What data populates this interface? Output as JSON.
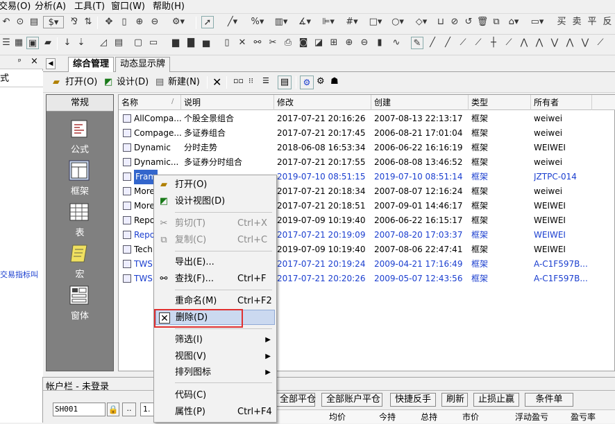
{
  "menubar": {
    "items": [
      "交易(O)",
      "分析(A)",
      "工具(T)",
      "窗口(W)",
      "帮助(H)"
    ]
  },
  "leftpane": {
    "title_fragment": "式",
    "pin": "ᵖ",
    "close": "×",
    "side_text": "交易指标叫"
  },
  "tabs": {
    "back_arrow": "◀",
    "items": [
      "综合管理",
      "动态显示牌"
    ]
  },
  "cmdbar": {
    "open": "打开(O)",
    "design": "设计(D)",
    "new": "新建(N)"
  },
  "categories": {
    "header": "常规",
    "items": [
      "公式",
      "框架",
      "表",
      "宏",
      "窗体"
    ]
  },
  "list": {
    "columns": [
      "名称",
      "说明",
      "修改",
      "创建",
      "类型",
      "所有者"
    ],
    "rows": [
      {
        "name": "AllCompa...",
        "desc": "个股全景组合",
        "mod": "2017-07-21 20:16:26",
        "created": "2007-08-13 22:13:17",
        "type": "框架",
        "owner": "weiwei",
        "blue": false
      },
      {
        "name": "Compage...",
        "desc": "多证券组合",
        "mod": "2017-07-21 20:17:45",
        "created": "2006-08-21 17:01:04",
        "type": "框架",
        "owner": "weiwei",
        "blue": false
      },
      {
        "name": "Dynamic",
        "desc": "分时走势",
        "mod": "2018-06-08 16:53:34",
        "created": "2006-06-22 16:16:19",
        "type": "框架",
        "owner": "WEIWEI",
        "blue": false
      },
      {
        "name": "Dynamic...",
        "desc": "多证券分时组合",
        "mod": "2017-07-21 20:17:55",
        "created": "2006-08-08 13:46:52",
        "type": "框架",
        "owner": "weiwei",
        "blue": false
      },
      {
        "name": "Fram",
        "desc": "",
        "mod": "2019-07-10 08:51:15",
        "created": "2019-07-10 08:51:14",
        "type": "框架",
        "owner": "JZTPC-014",
        "blue": true
      },
      {
        "name": "More",
        "desc": "",
        "mod": "2017-07-21 20:18:34",
        "created": "2007-08-07 12:16:24",
        "type": "框架",
        "owner": "weiwei",
        "blue": false
      },
      {
        "name": "More",
        "desc": "",
        "mod": "2017-07-21 20:18:51",
        "created": "2007-09-01 14:46:17",
        "type": "框架",
        "owner": "WEIWEI",
        "blue": false
      },
      {
        "name": "Repo",
        "desc": "",
        "mod": "2019-07-09 10:19:40",
        "created": "2006-06-22 16:15:17",
        "type": "框架",
        "owner": "WEIWEI",
        "blue": false
      },
      {
        "name": "Repo",
        "desc": "",
        "mod": "2017-07-21 20:19:09",
        "created": "2007-08-20 17:03:37",
        "type": "框架",
        "owner": "WEIWEI",
        "blue": true
      },
      {
        "name": "Tech",
        "desc": "",
        "mod": "2019-07-09 10:19:40",
        "created": "2007-08-06 22:47:41",
        "type": "框架",
        "owner": "WEIWEI",
        "blue": false
      },
      {
        "name": "TWS",
        "desc": "",
        "mod": "2017-07-21 20:19:24",
        "created": "2009-04-21 17:16:49",
        "type": "框架",
        "owner": "A-C1F597B...",
        "blue": true
      },
      {
        "name": "TWS",
        "desc": "",
        "mod": "2017-07-21 20:20:26",
        "created": "2009-05-07 12:43:56",
        "type": "框架",
        "owner": "A-C1F597B...",
        "blue": true
      }
    ]
  },
  "context_menu": {
    "items": [
      {
        "label": "打开(O)",
        "shortcut": "",
        "disabled": false,
        "icon": "open-icon"
      },
      {
        "label": "设计视图(D)",
        "shortcut": "",
        "disabled": false,
        "icon": "design-icon"
      },
      {
        "label": "剪切(T)",
        "shortcut": "Ctrl+X",
        "disabled": true,
        "icon": "scissors-icon"
      },
      {
        "label": "复制(C)",
        "shortcut": "Ctrl+C",
        "disabled": true,
        "icon": "copy-icon"
      },
      {
        "label": "导出(E)...",
        "shortcut": "",
        "disabled": false,
        "icon": ""
      },
      {
        "label": "查找(F)...",
        "shortcut": "Ctrl+F",
        "disabled": false,
        "icon": "binoculars-icon"
      },
      {
        "label": "重命名(M)",
        "shortcut": "Ctrl+F2",
        "disabled": false,
        "icon": ""
      },
      {
        "label": "删除(D)",
        "shortcut": "",
        "disabled": false,
        "icon": "delete-icon"
      },
      {
        "label": "筛选(I)",
        "shortcut": "",
        "disabled": false,
        "icon": ""
      },
      {
        "label": "视图(V)",
        "shortcut": "",
        "disabled": false,
        "icon": ""
      },
      {
        "label": "排列图标",
        "shortcut": "",
        "disabled": false,
        "icon": ""
      },
      {
        "label": "代码(C)",
        "shortcut": "",
        "disabled": false,
        "icon": ""
      },
      {
        "label": "属性(P)",
        "shortcut": "Ctrl+F4",
        "disabled": false,
        "icon": ""
      }
    ]
  },
  "account": {
    "title": "帐户栏 - 未登录",
    "account_id": "SH001",
    "dots": "..",
    "field_value": "1.",
    "buttons": [
      "全部平仓",
      "全部账户平仓",
      "快捷反手",
      "刷新",
      "止损止赢",
      "条件单"
    ],
    "columns": [
      "均价",
      "今持",
      "总持",
      "市价",
      "浮动盈亏",
      "盈亏率"
    ]
  },
  "accent_color": "#1a3ecf",
  "highlight_color": "#e03030"
}
